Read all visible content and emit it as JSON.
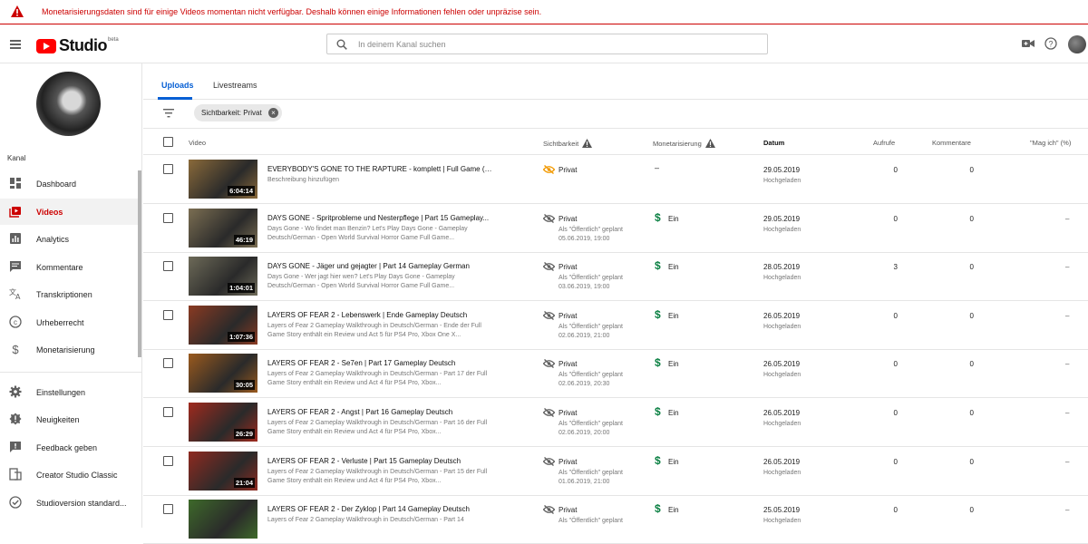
{
  "banner": {
    "message": "Monetarisierungsdaten sind für einige Videos momentan nicht verfügbar. Deshalb können einige Informationen fehlen oder unpräzise sein.",
    "color": "#cc0000"
  },
  "topbar": {
    "logo_text": "Studio",
    "logo_badge": "beta",
    "search_placeholder": "In deinem Kanal suchen"
  },
  "sidebar": {
    "channel_label": "Kanal",
    "items": [
      {
        "label": "Dashboard",
        "icon": "dashboard-icon"
      },
      {
        "label": "Videos",
        "icon": "videos-icon",
        "active": true
      },
      {
        "label": "Analytics",
        "icon": "analytics-icon"
      },
      {
        "label": "Kommentare",
        "icon": "comments-icon"
      },
      {
        "label": "Transkriptionen",
        "icon": "translate-icon"
      },
      {
        "label": "Urheberrecht",
        "icon": "copyright-icon"
      },
      {
        "label": "Monetarisierung",
        "icon": "dollar-icon"
      }
    ],
    "bottom_items": [
      {
        "label": "Einstellungen",
        "icon": "gear-icon"
      },
      {
        "label": "Neuigkeiten",
        "icon": "alert-icon"
      },
      {
        "label": "Feedback geben",
        "icon": "feedback-icon"
      },
      {
        "label": "Creator Studio Classic",
        "icon": "classic-icon"
      },
      {
        "label": "Studioversion standard...",
        "icon": "check-circle-icon"
      }
    ]
  },
  "tabs": [
    {
      "label": "Uploads",
      "active": true
    },
    {
      "label": "Livestreams"
    }
  ],
  "filter_chip": "Sichtbarkeit: Privat",
  "columns": {
    "video": "Video",
    "visibility": "Sichtbarkeit",
    "monetization": "Monetarisierung",
    "date": "Datum",
    "views": "Aufrufe",
    "comments": "Kommentare",
    "likes": "\"Mag ich\" (%)"
  },
  "videos": [
    {
      "title": "EVERYBODY'S GONE TO THE RAPTURE - komplett | Full Game (Re...",
      "desc": "Beschreibung hinzufügen",
      "duration": "6:04:14",
      "visibility": "Privat",
      "scheduled": "",
      "scheduled_time": "",
      "monetization": "–",
      "monetized": false,
      "date": "29.05.2019",
      "date_status": "Hochgeladen",
      "views": "0",
      "comments": "0",
      "likes": "",
      "thumb_color": "#8a6a3a",
      "vis_icon_color": "#f29900"
    },
    {
      "title": "DAYS GONE - Spritprobleme und Nesterpflege | Part 15 Gameplay...",
      "desc": "Days Gone - Wo findet man Benzin? Let's Play Days Gone - Gameplay Deutsch/German - Open World Survival Horror Game Full Game...",
      "duration": "46:19",
      "visibility": "Privat",
      "scheduled": "Als \"Öffentlich\" geplant",
      "scheduled_time": "05.06.2019, 19:00",
      "monetization": "Ein",
      "monetized": true,
      "date": "29.05.2019",
      "date_status": "Hochgeladen",
      "views": "0",
      "comments": "0",
      "likes": "–",
      "thumb_color": "#7b6e52",
      "vis_icon_color": "#606060"
    },
    {
      "title": "DAYS GONE - Jäger und gejagter | Part 14 Gameplay German",
      "desc": "Days Gone - Wer jagt hier wen? Let's Play Days Gone - Gameplay Deutsch/German - Open World Survival Horror Game Full Game...",
      "duration": "1:04:01",
      "visibility": "Privat",
      "scheduled": "Als \"Öffentlich\" geplant",
      "scheduled_time": "03.06.2019, 19:00",
      "monetization": "Ein",
      "monetized": true,
      "date": "28.05.2019",
      "date_status": "Hochgeladen",
      "views": "3",
      "comments": "0",
      "likes": "–",
      "thumb_color": "#6d6a58",
      "vis_icon_color": "#606060"
    },
    {
      "title": "LAYERS OF FEAR 2 - Lebenswerk | Ende Gameplay Deutsch",
      "desc": "Layers of Fear 2 Gameplay Walkthrough in Deutsch/German - Ende der Full Game Story enthält ein Review und Act 5 für PS4 Pro, Xbox One X...",
      "duration": "1:07:36",
      "visibility": "Privat",
      "scheduled": "Als \"Öffentlich\" geplant",
      "scheduled_time": "02.06.2019, 21:00",
      "monetization": "Ein",
      "monetized": true,
      "date": "26.05.2019",
      "date_status": "Hochgeladen",
      "views": "0",
      "comments": "0",
      "likes": "–",
      "thumb_color": "#8a3a22",
      "vis_icon_color": "#606060"
    },
    {
      "title": "LAYERS OF FEAR 2 - Se7en | Part 17 Gameplay Deutsch",
      "desc": "Layers of Fear 2 Gameplay Walkthrough in Deutsch/German - Part 17 der Full Game Story enthält ein Review und Act 4 für PS4 Pro, Xbox...",
      "duration": "30:05",
      "visibility": "Privat",
      "scheduled": "Als \"Öffentlich\" geplant",
      "scheduled_time": "02.06.2019, 20:30",
      "monetization": "Ein",
      "monetized": true,
      "date": "26.05.2019",
      "date_status": "Hochgeladen",
      "views": "0",
      "comments": "0",
      "likes": "–",
      "thumb_color": "#9a5a1e",
      "vis_icon_color": "#606060"
    },
    {
      "title": "LAYERS OF FEAR 2 - Angst | Part 16 Gameplay Deutsch",
      "desc": "Layers of Fear 2 Gameplay Walkthrough in Deutsch/German - Part 16 der Full Game Story enthält ein Review und Act 4 für PS4 Pro, Xbox...",
      "duration": "26:29",
      "visibility": "Privat",
      "scheduled": "Als \"Öffentlich\" geplant",
      "scheduled_time": "02.06.2019, 20:00",
      "monetization": "Ein",
      "monetized": true,
      "date": "26.05.2019",
      "date_status": "Hochgeladen",
      "views": "0",
      "comments": "0",
      "likes": "–",
      "thumb_color": "#a02a1e",
      "vis_icon_color": "#606060"
    },
    {
      "title": "LAYERS OF FEAR 2 - Verluste | Part 15 Gameplay Deutsch",
      "desc": "Layers of Fear 2 Gameplay Walkthrough in Deutsch/German - Part 15 der Full Game Story enthält ein Review und Act 4 für PS4 Pro, Xbox...",
      "duration": "21:04",
      "visibility": "Privat",
      "scheduled": "Als \"Öffentlich\" geplant",
      "scheduled_time": "01.06.2019, 21:00",
      "monetization": "Ein",
      "monetized": true,
      "date": "26.05.2019",
      "date_status": "Hochgeladen",
      "views": "0",
      "comments": "0",
      "likes": "–",
      "thumb_color": "#8f2a20",
      "vis_icon_color": "#606060"
    },
    {
      "title": "LAYERS OF FEAR 2 - Der Zyklop | Part 14 Gameplay Deutsch",
      "desc": "Layers of Fear 2 Gameplay Walkthrough in Deutsch/German - Part 14",
      "duration": "",
      "visibility": "Privat",
      "scheduled": "Als \"Öffentlich\" geplant",
      "scheduled_time": "",
      "monetization": "Ein",
      "monetized": true,
      "date": "25.05.2019",
      "date_status": "Hochgeladen",
      "views": "0",
      "comments": "0",
      "likes": "–",
      "thumb_color": "#3e6a2a",
      "vis_icon_color": "#606060"
    }
  ]
}
